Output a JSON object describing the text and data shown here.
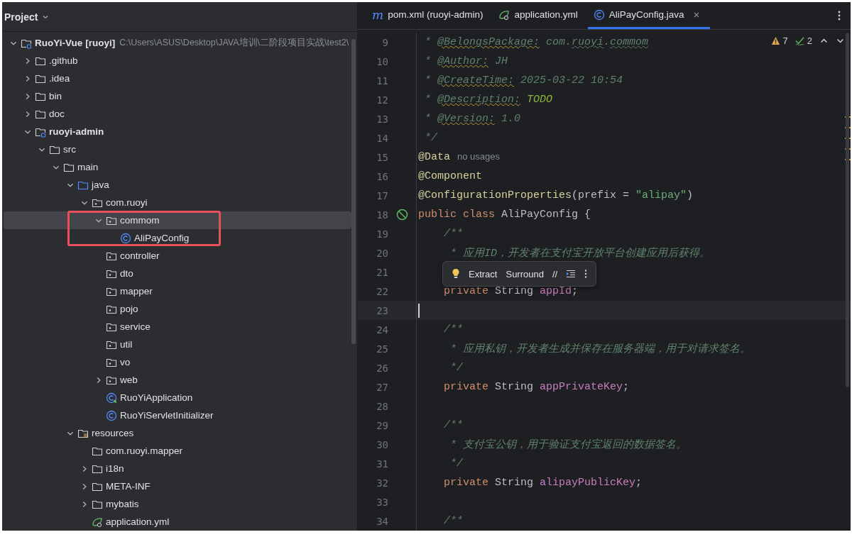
{
  "project_panel": {
    "title": "Project",
    "tree": [
      {
        "label": "RuoYi-Vue",
        "suffix": "[ruoyi]",
        "path": "C:\\Users\\ASUS\\Desktop\\JAVA培训\\二阶段项目实战\\test2\\",
        "kind": "project",
        "expanded": true,
        "selected": false,
        "children": [
          {
            "label": ".github",
            "kind": "folder",
            "expanded": false,
            "selected": false
          },
          {
            "label": ".idea",
            "kind": "folder",
            "expanded": false,
            "selected": false
          },
          {
            "label": "bin",
            "kind": "folder",
            "expanded": false,
            "selected": false
          },
          {
            "label": "doc",
            "kind": "folder",
            "expanded": false,
            "selected": false
          },
          {
            "label": "ruoyi-admin",
            "kind": "module",
            "expanded": true,
            "selected": false,
            "children": [
              {
                "label": "src",
                "kind": "folder",
                "expanded": true,
                "selected": false,
                "children": [
                  {
                    "label": "main",
                    "kind": "folder",
                    "expanded": true,
                    "selected": false,
                    "children": [
                      {
                        "label": "java",
                        "kind": "source-folder",
                        "expanded": true,
                        "selected": false,
                        "children": [
                          {
                            "label": "com.ruoyi",
                            "kind": "package",
                            "expanded": true,
                            "selected": false,
                            "children": [
                              {
                                "label": "commom",
                                "kind": "package",
                                "expanded": true,
                                "selected": true,
                                "marked": true,
                                "children": [
                                  {
                                    "label": "AliPayConfig",
                                    "kind": "class",
                                    "selected": false
                                  }
                                ]
                              },
                              {
                                "label": "controller",
                                "kind": "package",
                                "selected": false
                              },
                              {
                                "label": "dto",
                                "kind": "package",
                                "selected": false
                              },
                              {
                                "label": "mapper",
                                "kind": "package",
                                "selected": false
                              },
                              {
                                "label": "pojo",
                                "kind": "package",
                                "selected": false
                              },
                              {
                                "label": "service",
                                "kind": "package",
                                "selected": false
                              },
                              {
                                "label": "util",
                                "kind": "package",
                                "selected": false
                              },
                              {
                                "label": "vo",
                                "kind": "package",
                                "selected": false
                              },
                              {
                                "label": "web",
                                "kind": "package",
                                "expanded": false,
                                "selected": false
                              },
                              {
                                "label": "RuoYiApplication",
                                "kind": "spring-class",
                                "selected": false
                              },
                              {
                                "label": "RuoYiServletInitializer",
                                "kind": "class",
                                "selected": false
                              }
                            ]
                          }
                        ]
                      },
                      {
                        "label": "resources",
                        "kind": "resources",
                        "expanded": true,
                        "selected": false,
                        "children": [
                          {
                            "label": "com.ruoyi.mapper",
                            "kind": "folder",
                            "selected": false
                          },
                          {
                            "label": "i18n",
                            "kind": "folder",
                            "expanded": false,
                            "selected": false
                          },
                          {
                            "label": "META-INF",
                            "kind": "folder",
                            "expanded": false,
                            "selected": false
                          },
                          {
                            "label": "mybatis",
                            "kind": "folder",
                            "expanded": false,
                            "selected": false
                          },
                          {
                            "label": "application.yml",
                            "kind": "yml",
                            "selected": false
                          }
                        ]
                      }
                    ]
                  }
                ]
              }
            ]
          }
        ]
      }
    ]
  },
  "tabs": [
    {
      "label": "pom.xml (ruoyi-admin)",
      "kind": "maven",
      "icon": "m",
      "selected": false
    },
    {
      "label": "application.yml",
      "kind": "yml",
      "selected": false
    },
    {
      "label": "AliPayConfig.java",
      "kind": "class",
      "selected": true
    }
  ],
  "inspections": {
    "warnings": "7",
    "weak_warnings": "2"
  },
  "code_lines": [
    {
      "number": "9",
      "current": false,
      "tokens": [
        {
          "kind": "doc",
          "text": " * "
        },
        {
          "kind": "doc-tag",
          "text": "@BelongsPackage:"
        },
        {
          "kind": "doc",
          "text": " com."
        },
        {
          "kind": "doc-typo",
          "text": "ruoyi"
        },
        {
          "kind": "doc",
          "text": "."
        },
        {
          "kind": "doc-typo",
          "text": "commom"
        }
      ]
    },
    {
      "number": "10",
      "current": false,
      "tokens": [
        {
          "kind": "doc",
          "text": " * "
        },
        {
          "kind": "doc-tag",
          "text": "@Author:"
        },
        {
          "kind": "doc",
          "text": " JH"
        }
      ]
    },
    {
      "number": "11",
      "current": false,
      "tokens": [
        {
          "kind": "doc",
          "text": " * "
        },
        {
          "kind": "doc-tag",
          "text": "@CreateTime:"
        },
        {
          "kind": "doc",
          "text": " 2025-03-22 10:54"
        }
      ]
    },
    {
      "number": "12",
      "current": false,
      "tokens": [
        {
          "kind": "doc",
          "text": " * "
        },
        {
          "kind": "doc-tag",
          "text": "@Description:"
        },
        {
          "kind": "todo",
          "text": " TODO"
        }
      ]
    },
    {
      "number": "13",
      "current": false,
      "tokens": [
        {
          "kind": "doc",
          "text": " * "
        },
        {
          "kind": "doc-tag",
          "text": "@Version:"
        },
        {
          "kind": "doc",
          "text": " 1.0"
        }
      ]
    },
    {
      "number": "14",
      "current": false,
      "tokens": [
        {
          "kind": "doc",
          "text": " */"
        }
      ]
    },
    {
      "number": "15",
      "current": false,
      "tokens": [
        {
          "kind": "annotation",
          "text": "@Data"
        },
        {
          "kind": "hint",
          "text": "no usages"
        }
      ]
    },
    {
      "number": "16",
      "current": false,
      "tokens": [
        {
          "kind": "annotation",
          "text": "@Component"
        }
      ]
    },
    {
      "number": "17",
      "current": false,
      "tokens": [
        {
          "kind": "annotation",
          "text": "@ConfigurationProperties"
        },
        {
          "kind": "plain",
          "text": "(prefix = "
        },
        {
          "kind": "string",
          "text": "\"alipay\""
        },
        {
          "kind": "plain",
          "text": ")"
        }
      ]
    },
    {
      "number": "18",
      "current": false,
      "gutter_icon": true,
      "tokens": [
        {
          "kind": "keyword",
          "text": "public class "
        },
        {
          "kind": "class-name",
          "text": "AliPayConfig"
        },
        {
          "kind": "plain",
          "text": " {"
        }
      ]
    },
    {
      "number": "19",
      "current": false,
      "tokens": [
        {
          "kind": "doc",
          "text": "    /**"
        }
      ]
    },
    {
      "number": "20",
      "current": false,
      "tokens": [
        {
          "kind": "doc",
          "text": "     * 应用ID，开发者在支付宝开放平台创建应用后获得。"
        }
      ]
    },
    {
      "number": "21",
      "current": false
    },
    {
      "number": "22",
      "current": false,
      "tokens": [
        {
          "kind": "keyword",
          "text": "    private "
        },
        {
          "kind": "plain",
          "text": "String "
        },
        {
          "kind": "field",
          "text": "appId"
        },
        {
          "kind": "plain",
          "text": ";"
        }
      ]
    },
    {
      "number": "23",
      "current": true
    },
    {
      "number": "24",
      "current": false,
      "tokens": [
        {
          "kind": "doc",
          "text": "    /**"
        }
      ]
    },
    {
      "number": "25",
      "current": false,
      "tokens": [
        {
          "kind": "doc",
          "text": "     * 应用私钥，开发者生成并保存在服务器端，用于对请求签名。"
        }
      ]
    },
    {
      "number": "26",
      "current": false,
      "tokens": [
        {
          "kind": "doc",
          "text": "     */"
        }
      ]
    },
    {
      "number": "27",
      "current": false,
      "tokens": [
        {
          "kind": "keyword",
          "text": "    private "
        },
        {
          "kind": "plain",
          "text": "String "
        },
        {
          "kind": "field",
          "text": "appPrivateKey"
        },
        {
          "kind": "plain",
          "text": ";"
        }
      ]
    },
    {
      "number": "28",
      "current": false
    },
    {
      "number": "29",
      "current": false,
      "tokens": [
        {
          "kind": "doc",
          "text": "    /**"
        }
      ]
    },
    {
      "number": "30",
      "current": false,
      "tokens": [
        {
          "kind": "doc",
          "text": "     * 支付宝公钥，用于验证支付宝返回的数据签名。"
        }
      ]
    },
    {
      "number": "31",
      "current": false,
      "tokens": [
        {
          "kind": "doc",
          "text": "     */"
        }
      ]
    },
    {
      "number": "32",
      "current": false,
      "tokens": [
        {
          "kind": "keyword",
          "text": "    private "
        },
        {
          "kind": "plain",
          "text": "String "
        },
        {
          "kind": "field",
          "text": "alipayPublicKey"
        },
        {
          "kind": "plain",
          "text": ";"
        }
      ]
    },
    {
      "number": "33",
      "current": false
    },
    {
      "number": "34",
      "current": false,
      "tokens": [
        {
          "kind": "doc",
          "text": "    /**"
        }
      ]
    }
  ],
  "floating_toolbar": {
    "actions": [
      {
        "label": "Extract",
        "kind": "text"
      },
      {
        "label": "Surround",
        "kind": "text"
      },
      {
        "label": "//",
        "kind": "text"
      }
    ]
  }
}
